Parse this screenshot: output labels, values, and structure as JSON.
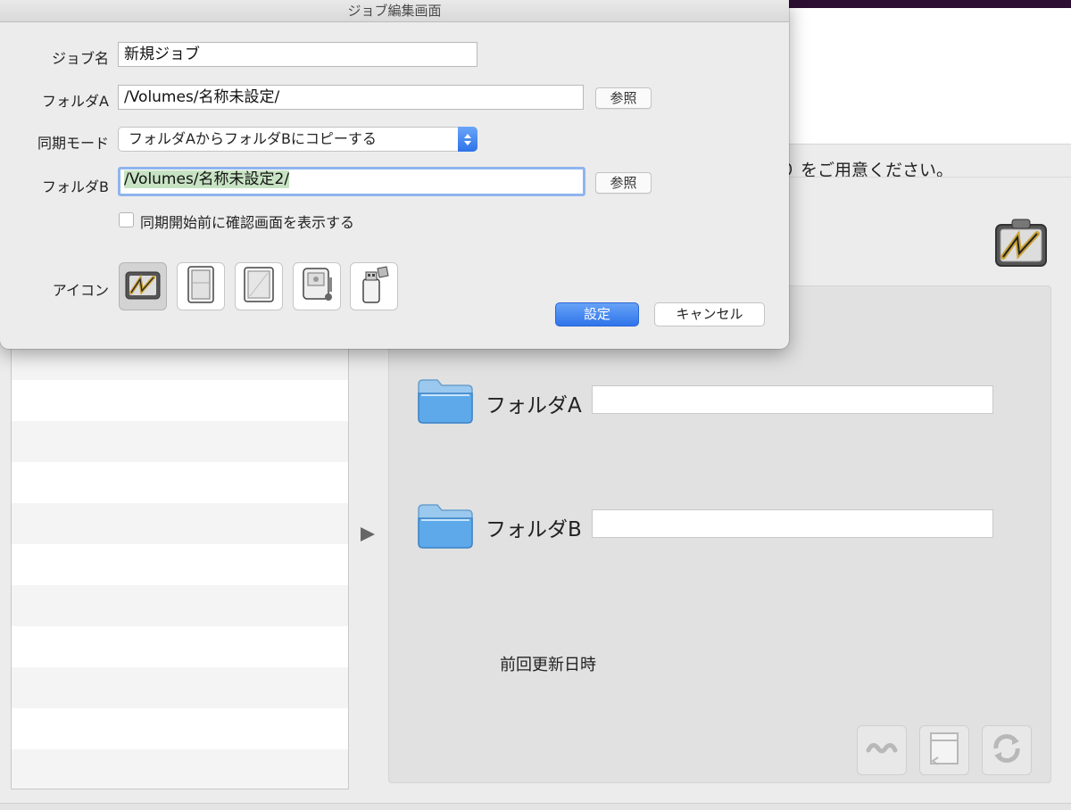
{
  "background": {
    "instruction_text": "り をご用意ください。",
    "folder_a_label": "フォルダA",
    "folder_b_label": "フォルダB",
    "last_update_label": "前回更新日時",
    "folder_a_value": "",
    "folder_b_value": "",
    "toolbar": [
      {
        "name": "link-tool-button",
        "icon": "link-icon"
      },
      {
        "name": "log-tool-button",
        "icon": "document-icon"
      },
      {
        "name": "sync-tool-button",
        "icon": "sync-icon"
      }
    ],
    "list_rows": 11
  },
  "dialog": {
    "title": "ジョブ編集画面",
    "job_name_label": "ジョブ名",
    "job_name_value": "新規ジョブ",
    "folder_a_label": "フォルダA",
    "folder_a_value": "/Volumes/名称未設定/",
    "browse_label": "参照",
    "sync_mode_label": "同期モード",
    "sync_mode_value": "フォルダAからフォルダBにコピーする",
    "folder_b_label": "フォルダB",
    "folder_b_value": "/Volumes/名称未設定2/",
    "confirm_checkbox_label": "同期開始前に確認画面を表示する",
    "confirm_checked": false,
    "icon_label": "アイコン",
    "icons": [
      "sync-app-icon",
      "external-drive-icon",
      "hard-disk-icon",
      "server-drive-icon",
      "usb-drive-icon"
    ],
    "selected_icon_index": 0,
    "ok_label": "設定",
    "cancel_label": "キャンセル"
  },
  "colors": {
    "accent": "#2f74ea",
    "selection": "#c8e3c4",
    "focus_ring": "#8fb4ef",
    "top_bar": "#2c0f33"
  }
}
